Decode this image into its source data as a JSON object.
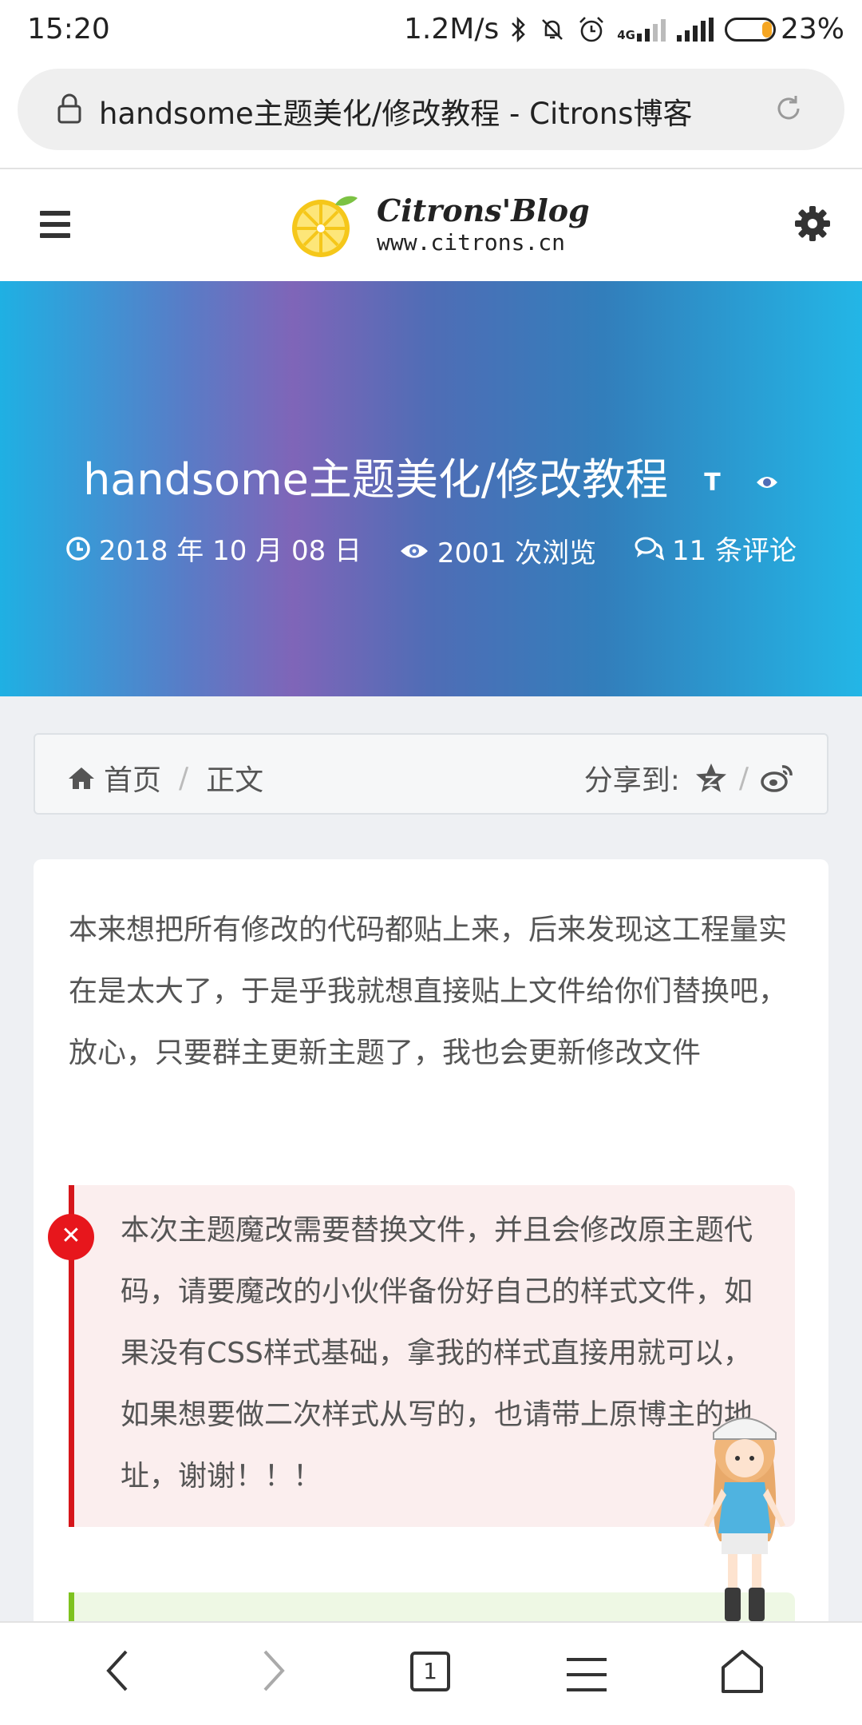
{
  "status_bar": {
    "time": "15:20",
    "speed": "1.2M/s",
    "network": "4G",
    "battery": "23%",
    "battery_level": 0.23,
    "icons": [
      "bluetooth-icon",
      "mute-bell-icon",
      "alarm-icon",
      "signal-4g-icon",
      "signal-icon",
      "battery-icon"
    ]
  },
  "url_bar": {
    "title": "handsome主题美化/修改教程 - Citrons博客",
    "icons": [
      "lock-icon",
      "reload-icon"
    ]
  },
  "site_header": {
    "logo_title": "Citrons'Blog",
    "logo_sub": "www.citrons.cn",
    "icons": [
      "menu-icon",
      "lemon-logo-icon",
      "settings-gear-icon"
    ]
  },
  "hero": {
    "title": "handsome主题美化/修改教程",
    "font_toggle": "T",
    "date": "2018 年 10 月 08 日",
    "views": "2001 次浏览",
    "comments": "11 条评论",
    "icons": [
      "font-size-icon",
      "eye-toggle-icon",
      "clock-icon",
      "eye-icon",
      "comments-icon"
    ]
  },
  "breadcrumb": {
    "home": "首页",
    "current": "正文",
    "share_label": "分享到:",
    "icons": [
      "home-icon",
      "qzone-star-icon",
      "weibo-icon"
    ]
  },
  "article": {
    "intro": "本来想把所有修改的代码都贴上来，后来发现这工程量实在是太大了，于是乎我就想直接贴上文件给你们替换吧，放心，只要群主更新主题了，我也会更新修改文件",
    "warning": "本次主题魔改需要替换文件，并且会修改原主题代码，请要魔改的小伙伴备份好自己的样式文件，如果没有CSS样式基础，拿我的样式直接用就可以，如果想要做二次样式从写的，也请带上原博主的地址，谢谢！！！",
    "warning_icon": "close-circle-icon",
    "colors": {
      "warning_border": "#d6161b",
      "warning_bg": "#fbeeee",
      "success_border": "#7ec21f",
      "success_bg": "#eef8e4"
    }
  },
  "bottom_nav": {
    "tab_count": "1",
    "icons": [
      "back-icon",
      "forward-icon",
      "tabs-icon",
      "menu-lines-icon",
      "home-outline-icon"
    ]
  },
  "mascot": "anime-mascot-icon"
}
